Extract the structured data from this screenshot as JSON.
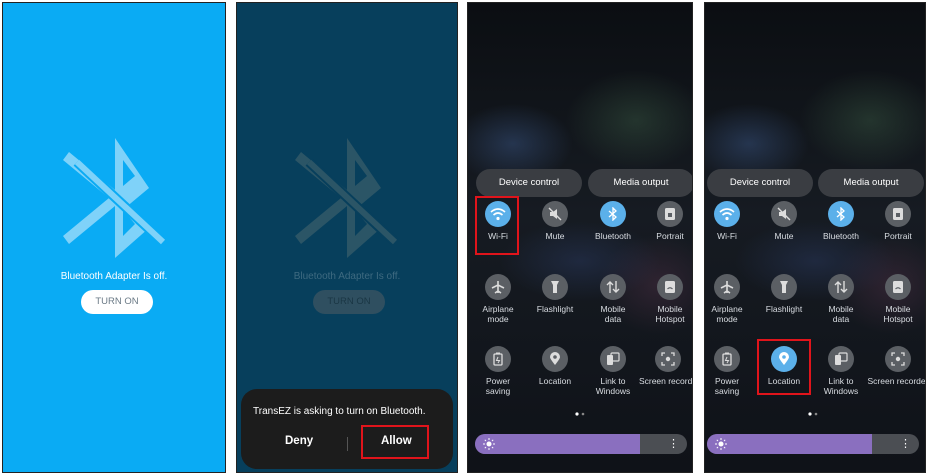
{
  "panel1": {
    "status_text": "Bluetooth Adapter Is off.",
    "turn_on_label": "TURN ON"
  },
  "panel2": {
    "status_text": "Bluetooth Adapter Is off.",
    "turn_on_label": "TURN ON",
    "dialog": {
      "message": "TransEZ is asking to turn on Bluetooth.",
      "deny_label": "Deny",
      "allow_label": "Allow"
    }
  },
  "panel3": {
    "buttons": {
      "device_control": "Device control",
      "media_output": "Media output"
    },
    "tiles": {
      "wifi": "Wi-Fi",
      "mute": "Mute",
      "bluetooth": "Bluetooth",
      "portrait": "Portrait",
      "airplane": "Airplane\nmode",
      "flashlight": "Flashlight",
      "mobile_data": "Mobile\ndata",
      "hotspot": "Mobile\nHotspot",
      "power_saving": "Power\nsaving",
      "location": "Location",
      "link_windows": "Link to\nWindows",
      "screen_recorder": "Screen recorde"
    },
    "brightness_level": 0.78
  },
  "panel4": {
    "buttons": {
      "device_control": "Device control",
      "media_output": "Media output"
    },
    "tiles": {
      "wifi": "Wi-Fi",
      "mute": "Mute",
      "bluetooth": "Bluetooth",
      "portrait": "Portrait",
      "airplane": "Airplane\nmode",
      "flashlight": "Flashlight",
      "mobile_data": "Mobile\ndata",
      "hotspot": "Mobile\nHotspot",
      "power_saving": "Power\nsaving",
      "location": "Location",
      "link_windows": "Link to\nWindows",
      "screen_recorder": "Screen recorder"
    },
    "brightness_level": 0.78
  },
  "colors": {
    "bt_blue": "#0aabf4",
    "dark_teal": "#073f5c",
    "highlight": "#e0141b",
    "tile_on": "#5bb0ea",
    "brightness": "#8a6fbf"
  }
}
